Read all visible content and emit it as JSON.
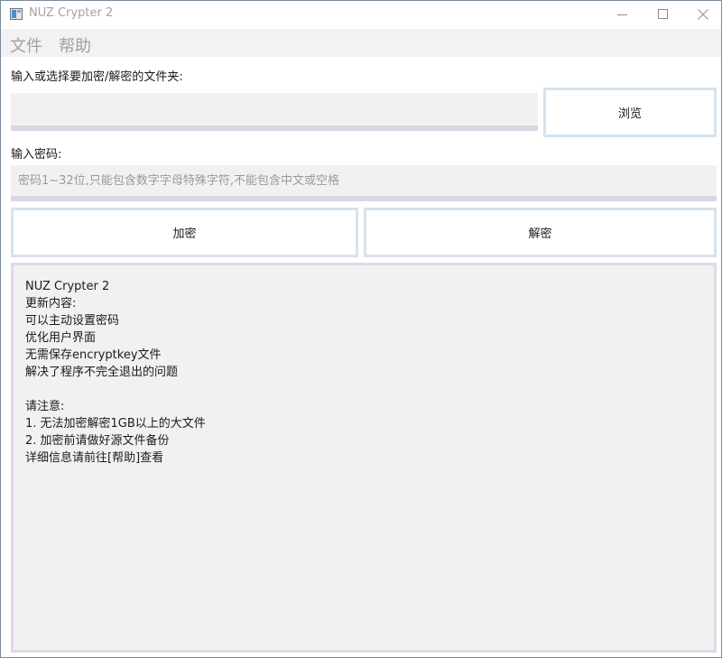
{
  "window": {
    "title": "NUZ Crypter 2"
  },
  "menu": {
    "file": "文件",
    "help": "帮助"
  },
  "folder": {
    "label": "输入或选择要加密/解密的文件夹:",
    "value": "",
    "browse_label": "浏览"
  },
  "password": {
    "label": "输入密码:",
    "placeholder": "密码1~32位,只能包含数字字母特殊字符,不能包含中文或空格"
  },
  "actions": {
    "encrypt_label": "加密",
    "decrypt_label": "解密"
  },
  "info": {
    "lines": [
      "NUZ Crypter 2",
      "更新内容:",
      "可以主动设置密码",
      "优化用户界面",
      "无需保存encryptkey文件",
      "解决了程序不完全退出的问题",
      "",
      "请注意:",
      "1. 无法加密解密1GB以上的大文件",
      "2. 加密前请做好源文件备份",
      "详细信息请前往[帮助]查看"
    ]
  }
}
